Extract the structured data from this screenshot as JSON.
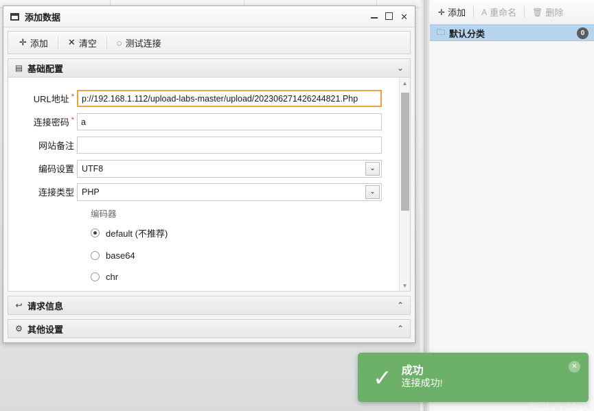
{
  "dialog": {
    "title": "添加数据",
    "window_controls": {
      "minimize": "–",
      "maximize": "□",
      "close": "✕"
    },
    "toolbar": [
      {
        "icon": "plus-circle-icon",
        "glyph": "✛",
        "label": "添加"
      },
      {
        "icon": "close-x-icon",
        "glyph": "✕",
        "label": "清空"
      },
      {
        "icon": "spinner-icon",
        "glyph": "◌",
        "label": "测试连接"
      }
    ],
    "sections": [
      {
        "key": "basic",
        "icon": "document-icon",
        "glyph": "▤",
        "label": "基础配置",
        "chevron": "⌄",
        "expanded": true
      },
      {
        "key": "request",
        "icon": "reply-arrow-icon",
        "glyph": "↩",
        "label": "请求信息",
        "chevron": "⌃",
        "expanded": false
      },
      {
        "key": "other",
        "icon": "gears-icon",
        "glyph": "⚙",
        "label": "其他设置",
        "chevron": "⌃",
        "expanded": false
      }
    ],
    "form": {
      "fields": [
        {
          "label": "URL地址",
          "required": true,
          "type": "text",
          "value": "p://192.168.1.112/upload-labs-master/upload/202306271426244821.Php",
          "placeholder": "",
          "focused": true
        },
        {
          "label": "连接密码",
          "required": true,
          "type": "text",
          "value": "a",
          "placeholder": "",
          "focused": false
        },
        {
          "label": "网站备注",
          "required": false,
          "type": "text",
          "value": "",
          "placeholder": "",
          "focused": false
        },
        {
          "label": "编码设置",
          "required": false,
          "type": "select",
          "value": "UTF8",
          "arrow": "⌄"
        },
        {
          "label": "连接类型",
          "required": false,
          "type": "select",
          "value": "PHP",
          "arrow": "⌄"
        }
      ],
      "encoder_group_title": "编码器",
      "encoder_options": [
        {
          "label": "default (不推荐)",
          "checked": true
        },
        {
          "label": "base64",
          "checked": false
        },
        {
          "label": "chr",
          "checked": false
        }
      ]
    },
    "scrollbar": {
      "up": "▲",
      "down": "▼"
    }
  },
  "right_panel": {
    "toolbar": [
      {
        "icon": "plus-circle-icon",
        "glyph": "✛",
        "label": "添加",
        "disabled": false
      },
      {
        "icon": "rename-a-icon",
        "glyph": "A",
        "label": "重命名",
        "disabled": true
      },
      {
        "icon": "trash-icon",
        "glyph": "🗑",
        "label": "删除",
        "disabled": true
      }
    ],
    "tree": [
      {
        "icon": "folder-icon",
        "glyph": "🗀",
        "label": "默认分类",
        "badge": "0",
        "selected": true
      }
    ]
  },
  "toast": {
    "icon": "check-icon",
    "glyph": "✓",
    "title": "成功",
    "message": "连接成功!",
    "close": "✕"
  },
  "watermark": "CSDN @p36273"
}
